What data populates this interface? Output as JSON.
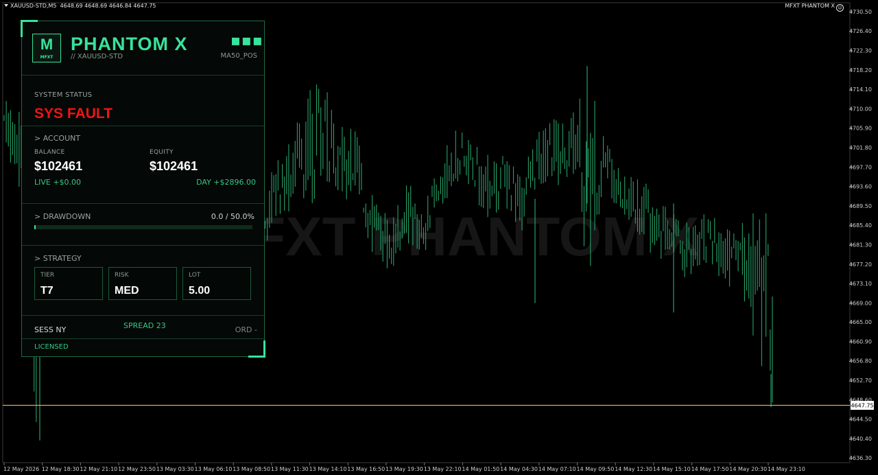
{
  "header": {
    "symbol": "XAUUSD-STD,M5",
    "ohlc": "4648.69 4648.69 4646.84 4647.75",
    "ea_name": "MFXT PHANTOM X"
  },
  "watermark": "MFXT PHANTOM X",
  "panel": {
    "logo_letter": "M",
    "logo_sub": "MFXT",
    "title": "PHANTOM X",
    "subtitle": "// XAUUSD-STD",
    "menu_icon": "ellipsis-icon",
    "mode": "MA50_POS",
    "status_label": "SYSTEM STATUS",
    "status_value": "SYS FAULT",
    "account": {
      "section": "> ACCOUNT",
      "balance_label": "BALANCE",
      "balance": "$102461",
      "equity_label": "EQUITY",
      "equity": "$102461",
      "live": "LIVE +$0.00",
      "day": "DAY +$2896.00"
    },
    "drawdown": {
      "section": "> DRAWDOWN",
      "value": "0.0 / 50.0%",
      "fraction": 0.0
    },
    "strategy": {
      "section": "> STRATEGY",
      "cards": [
        {
          "label": "TIER",
          "value": "T7"
        },
        {
          "label": "RISK",
          "value": "MED"
        },
        {
          "label": "LOT",
          "value": "5.00"
        }
      ]
    },
    "footer": {
      "session": "SESS NY",
      "spread": "SPREAD 23",
      "orders": "ORD -",
      "license": "LICENSED"
    }
  },
  "colors": {
    "accent": "#38e39b",
    "candle": "#26a269",
    "fault": "#f01414",
    "price_line": "#e9a45a"
  },
  "chart_data": {
    "type": "bar",
    "title": "",
    "ylim": [
      4635.6,
      4731.5
    ],
    "y_ticks": [
      "4730.50",
      "4726.40",
      "4722.30",
      "4718.20",
      "4714.10",
      "4710.00",
      "4705.90",
      "4701.80",
      "4697.70",
      "4693.60",
      "4689.50",
      "4685.40",
      "4681.30",
      "4677.20",
      "4673.10",
      "4669.00",
      "4665.00",
      "4660.90",
      "4656.80",
      "4652.70",
      "4648.60",
      "4644.50",
      "4640.40",
      "4636.30"
    ],
    "x_ticks": [
      "12 May 2026",
      "12 May 18:30",
      "12 May 21:10",
      "12 May 23:50",
      "13 May 03:30",
      "13 May 06:10",
      "13 May 08:50",
      "13 May 11:30",
      "13 May 14:10",
      "13 May 16:50",
      "13 May 19:30",
      "13 May 22:10",
      "14 May 01:50",
      "14 May 04:30",
      "14 May 07:10",
      "14 May 09:50",
      "14 May 12:30",
      "14 May 15:10",
      "14 May 17:50",
      "14 May 20:30",
      "14 May 23:10"
    ],
    "current_price": "4647.75",
    "closes": [
      4708,
      4702,
      4690,
      4694,
      4682,
      4684,
      4700,
      4706,
      4698,
      4701,
      4697,
      4702,
      4694,
      4684,
      4679,
      4682,
      4691,
      4695,
      4700,
      4706,
      4698,
      4700,
      4686,
      4681,
      4688,
      4684,
      4692,
      4700,
      4698,
      4693,
      4695,
      4691,
      4699,
      4700,
      4703,
      4695,
      4699,
      4692,
      4690,
      4685,
      4683,
      4681,
      4684,
      4678,
      4680,
      4677,
      4673
    ],
    "highs": [
      4712,
      4706,
      4694,
      4698,
      4686,
      4688,
      4705,
      4710,
      4702,
      4705,
      4701,
      4709,
      4698,
      4688,
      4684,
      4686,
      4696,
      4701,
      4712,
      4718,
      4705,
      4706,
      4692,
      4686,
      4693,
      4690,
      4696,
      4705,
      4703,
      4698,
      4699,
      4697,
      4705,
      4708,
      4710,
      4700,
      4702,
      4696,
      4694,
      4689,
      4688,
      4685,
      4688,
      4682,
      4684,
      4681,
      4677
    ],
    "lows": [
      4704,
      4690,
      4640,
      4690,
      4676,
      4680,
      4694,
      4700,
      4692,
      4695,
      4692,
      4698,
      4684,
      4669,
      4674,
      4676,
      4686,
      4689,
      4695,
      4696,
      4692,
      4694,
      4681,
      4676,
      4682,
      4680,
      4688,
      4694,
      4694,
      4687,
      4689,
      4686,
      4694,
      4695,
      4699,
      4668,
      4692,
      4688,
      4684,
      4678,
      4679,
      4674,
      4678,
      4672,
      4674,
      4660,
      4648
    ]
  }
}
